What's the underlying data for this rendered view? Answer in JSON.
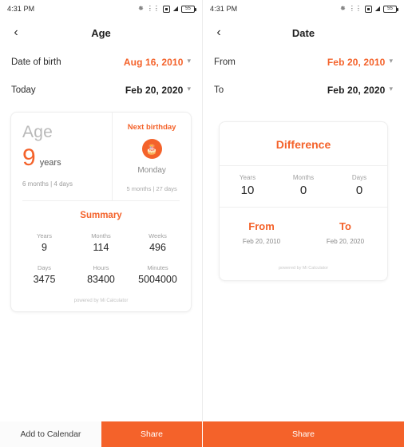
{
  "left": {
    "status": {
      "time": "4:31 PM",
      "battery": "55"
    },
    "appbar": {
      "back": "‹",
      "title": "Age"
    },
    "fields": [
      {
        "label": "Date of birth",
        "value": "Aug 16, 2010",
        "accent": true
      },
      {
        "label": "Today",
        "value": "Feb 20, 2020",
        "accent": false
      }
    ],
    "age_card": {
      "age_word": "Age",
      "age_number": "9",
      "age_unit": "years",
      "age_sub": "6 months | 4 days",
      "next_birthday_label": "Next birthday",
      "next_birthday_icon": "cake-icon",
      "next_birthday_day": "Monday",
      "next_birthday_sub": "5 months | 27 days",
      "summary_title": "Summary",
      "stats": [
        {
          "key": "Years",
          "value": "9"
        },
        {
          "key": "Months",
          "value": "114"
        },
        {
          "key": "Weeks",
          "value": "496"
        },
        {
          "key": "Days",
          "value": "3475"
        },
        {
          "key": "Hours",
          "value": "83400"
        },
        {
          "key": "Minutes",
          "value": "5004000"
        }
      ],
      "powered": "powered by Mi Calculator"
    }
  },
  "right": {
    "status": {
      "time": "4:31 PM",
      "battery": "55"
    },
    "appbar": {
      "back": "‹",
      "title": "Date"
    },
    "fields": [
      {
        "label": "From",
        "value": "Feb 20, 2010",
        "accent": true
      },
      {
        "label": "To",
        "value": "Feb 20, 2020",
        "accent": false
      }
    ],
    "diff_card": {
      "title": "Difference",
      "units": [
        {
          "key": "Years",
          "value": "10"
        },
        {
          "key": "Months",
          "value": "0"
        },
        {
          "key": "Days",
          "value": "0"
        }
      ],
      "endpoints": [
        {
          "key": "From",
          "value": "Feb 20, 2010"
        },
        {
          "key": "To",
          "value": "Feb 20, 2020"
        }
      ],
      "powered": "powered by Mi Calculator"
    }
  },
  "bottom": {
    "add_to_calendar": "Add to Calendar",
    "share_left": "Share",
    "share_right": "Share"
  },
  "colors": {
    "accent": "#f4622a",
    "text": "#262626",
    "muted": "#9f9f9f"
  }
}
